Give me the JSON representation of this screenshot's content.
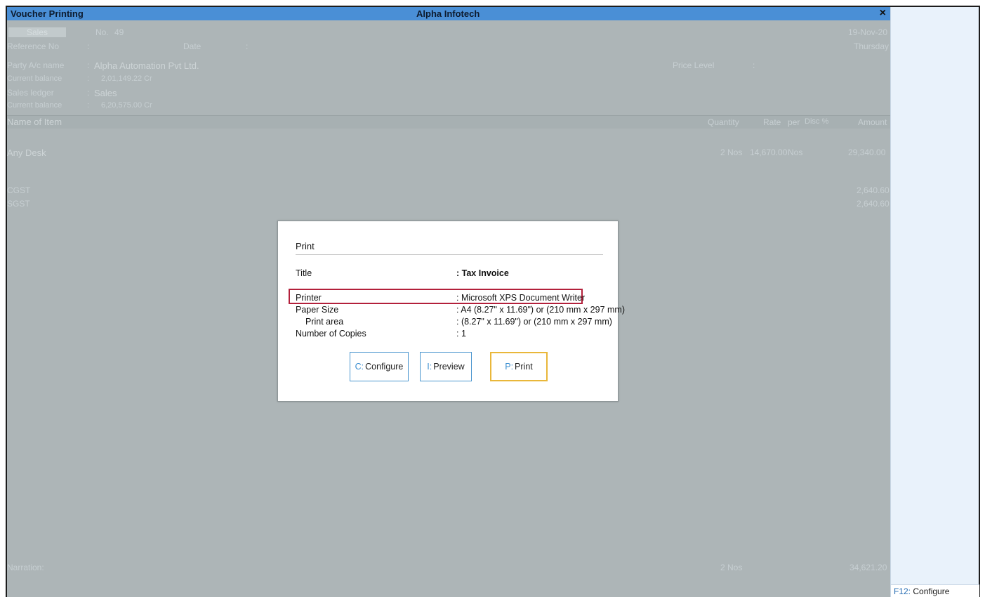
{
  "window": {
    "left_title": "Voucher Printing",
    "company": "Alpha Infotech",
    "close_glyph": "×"
  },
  "voucher": {
    "type_tab": "Sales",
    "no_label": "No.",
    "no_value": "49",
    "date_value": "19-Nov-20",
    "day_value": "Thursday",
    "reference_label": "Reference No",
    "reference_colon": ":",
    "date_label": "Date",
    "date_colon": ":",
    "party_label": "Party A/c name",
    "party_colon": ":",
    "party_value": "Alpha Automation Pvt Ltd.",
    "current_balance_label_1": "Current balance",
    "current_balance_colon_1": ":",
    "current_balance_value_1": "2,01,149.22 Cr",
    "sales_ledger_label": "Sales ledger",
    "sales_ledger_colon": ":",
    "sales_ledger_value": "Sales",
    "current_balance_label_2": "Current balance",
    "current_balance_colon_2": ":",
    "current_balance_value_2": "6,20,575.00 Cr",
    "price_level_label": "Price Level",
    "price_level_colon": ":",
    "columns": {
      "name": "Name of Item",
      "quantity": "Quantity",
      "rate": "Rate",
      "per": "per",
      "disc": "Disc %",
      "amount": "Amount"
    },
    "item": {
      "name": "Any Desk",
      "quantity": "2 Nos",
      "rate": "14,670.00",
      "per": "Nos",
      "amount": "29,340.00"
    },
    "taxes": [
      {
        "name": "CGST",
        "amount": "2,640.60"
      },
      {
        "name": "SGST",
        "amount": "2,640.60"
      }
    ],
    "narration_label": "Narration:",
    "total_quantity": "2 Nos",
    "total_amount": "34,621.20"
  },
  "dialog": {
    "title": "Print",
    "rows": {
      "title_label": "Title",
      "title_value": ": Tax Invoice",
      "printer_label": "Printer",
      "printer_value": ": Microsoft XPS Document Writer",
      "paper_size_label": "Paper Size",
      "paper_size_value": ": A4 (8.27\" x 11.69\") or (210 mm x 297 mm)",
      "print_area_label": "Print area",
      "print_area_value": ": (8.27\" x 11.69\") or (210 mm x 297 mm)",
      "copies_label": "Number of Copies",
      "copies_value": ": 1"
    },
    "buttons": {
      "configure_key": "C:",
      "configure_label": "Configure",
      "preview_key": "I:",
      "preview_label": "Preview",
      "print_key": "P:",
      "print_label": "Print"
    }
  },
  "sidebar": {
    "f12_key": "F12:",
    "f12_label": "Configure"
  },
  "colors": {
    "titlebar": "#4a8fd6",
    "overlay": "#adb5b7",
    "highlight": "#b3203b",
    "print_button_border": "#e9b73a",
    "button_border": "#4b96cf"
  }
}
